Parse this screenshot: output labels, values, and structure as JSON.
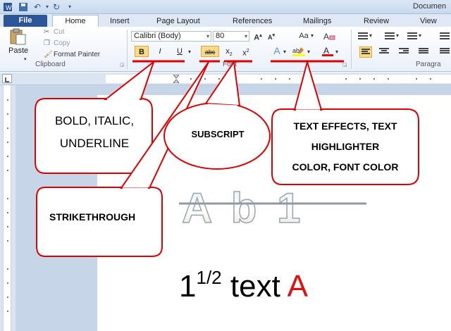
{
  "window": {
    "doc_title": "Documen"
  },
  "tabs": {
    "file": "File",
    "home": "Home",
    "insert": "Insert",
    "page_layout": "Page Layout",
    "references": "References",
    "mailings": "Mailings",
    "review": "Review",
    "view": "View"
  },
  "clipboard": {
    "paste": "Paste",
    "cut": "Cut",
    "copy": "Copy",
    "format_painter": "Format Painter",
    "group_label": "Clipboard"
  },
  "font": {
    "family": "Calibri (Body)",
    "size": "80",
    "bold": "B",
    "italic": "I",
    "underline": "U",
    "strikethrough": "abc",
    "subscript": "x",
    "superscript": "x",
    "change_case": "Aa",
    "group_label": "Font"
  },
  "paragraph": {
    "group_label": "Paragra"
  },
  "callouts": {
    "bold_italic_underline_line1": "BOLD, ITALIC,",
    "bold_italic_underline_line2": "UNDERLINE",
    "subscript": "SUBSCRIPT",
    "effects_line1": "TEXT EFFECTS, TEXT",
    "effects_line2": "HIGHLIGHTER",
    "effects_line3": "COLOR, FONT COLOR",
    "strikethrough": "STRIKETHROUGH"
  },
  "document": {
    "effect_sample": "A b 1",
    "sample_number": "1",
    "sample_fraction": "1/2",
    "sample_word": "text",
    "sample_red_letter": "A"
  },
  "colors": {
    "annotation_red": "#e00000",
    "font_color_red": "#e01010",
    "highlight_yellow": "#fbd98a",
    "file_tab_blue": "#2b579a"
  }
}
